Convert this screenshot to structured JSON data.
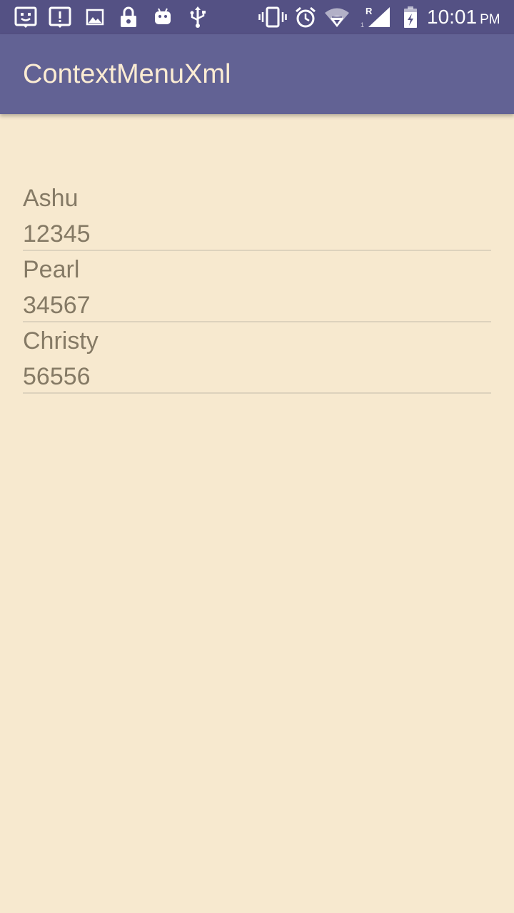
{
  "status_bar": {
    "time": "10:01",
    "ampm": "PM",
    "network_label": "R",
    "sim_slot": "1",
    "icons_left": [
      "notification-face-icon",
      "alert-message-icon",
      "image-icon",
      "lock-icon",
      "android-icon",
      "usb-icon"
    ],
    "icons_right": [
      "vibrate-icon",
      "alarm-icon",
      "wifi-icon",
      "cell-signal-icon",
      "battery-charging-icon"
    ]
  },
  "app_bar": {
    "title": "ContextMenuXml"
  },
  "contacts": [
    {
      "name": "Ashu",
      "number": "12345"
    },
    {
      "name": "Pearl",
      "number": "34567"
    },
    {
      "name": "Christy",
      "number": "56556"
    }
  ],
  "colors": {
    "status_bar": "#545184",
    "app_bar": "#626294",
    "title_text": "#fbecd3",
    "background": "#f7e9cf",
    "list_text": "#857a65",
    "divider": "#ddd2bd"
  }
}
